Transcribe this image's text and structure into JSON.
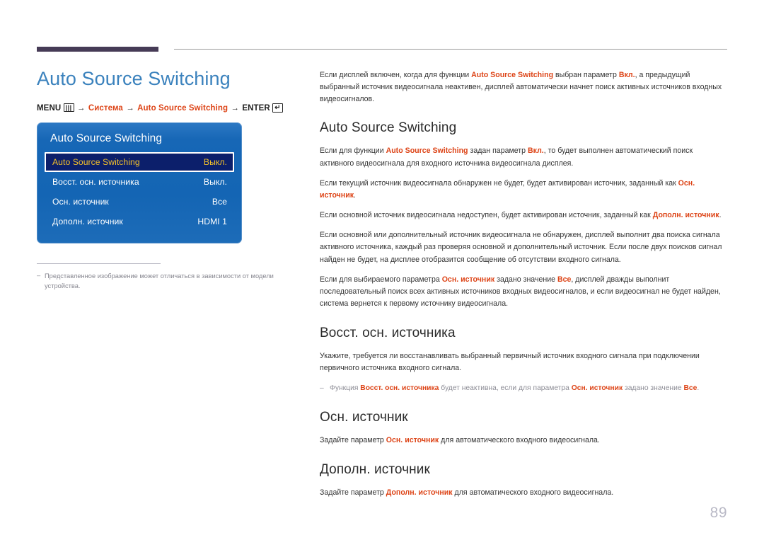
{
  "header": {
    "bar_color": "#463b56",
    "rule_color": "#9a9a9a"
  },
  "left": {
    "doc_title": "Auto Source Switching",
    "menu_path": {
      "menu_label": "MENU",
      "menu_icon": "menu-grid-icon",
      "arrow": "→",
      "step1": "Система",
      "step2": "Auto Source Switching",
      "enter_label": "ENTER",
      "enter_icon": "enter-return-icon"
    },
    "osd": {
      "title": "Auto Source Switching",
      "rows": [
        {
          "label": "Auto Source Switching",
          "value": "Выкл.",
          "selected": true
        },
        {
          "label": "Восст. осн. источника",
          "value": "Выкл.",
          "selected": false
        },
        {
          "label": "Осн. источник",
          "value": "Все",
          "selected": false
        },
        {
          "label": "Дополн. источник",
          "value": "HDMI 1",
          "selected": false
        }
      ],
      "bg_color": "#1767b6",
      "selected_bg": "#0c1f6b",
      "selected_text": "#f5c12a"
    },
    "note": {
      "dash": "‒",
      "text": "Представленное изображение может отличаться в зависимости от модели устройства."
    }
  },
  "right": {
    "intro": {
      "p1_a": "Если дисплей включен, когда для функции ",
      "p1_hl1": "Auto Source Switching",
      "p1_b": " выбран параметр ",
      "p1_hl2": "Вкл.",
      "p1_c": ", а предыдущий выбранный источник видеосигнала неактивен, дисплей автоматически начнет поиск активных источников входных видеосигналов."
    },
    "section1": {
      "heading": "Auto Source Switching",
      "p1_a": "Если для функции ",
      "p1_hl1": "Auto Source Switching",
      "p1_b": " задан параметр ",
      "p1_hl2": "Вкл.",
      "p1_c": ", то будет выполнен автоматический поиск активного видеосигнала для входного источника видеосигнала дисплея.",
      "p2_a": "Если текущий источник видеосигнала обнаружен не будет, будет активирован источник, заданный как ",
      "p2_hl": "Осн. источник",
      "p2_b": ".",
      "p3_a": "Если основной источник видеосигнала недоступен, будет активирован источник, заданный как ",
      "p3_hl": "Дополн. источник",
      "p3_b": ".",
      "p4": "Если основной или дополнительный источник видеосигнала не обнаружен, дисплей выполнит два поиска сигнала активного источника, каждый раз проверяя основной и дополнительный источник. Если после двух поисков сигнал найден не будет, на дисплее отобразится сообщение об отсутствии входного сигнала.",
      "p5_a": "Если для выбираемого параметра ",
      "p5_hl1": "Осн. источник",
      "p5_b": " задано значение ",
      "p5_hl2": "Все",
      "p5_c": ", дисплей дважды выполнит последовательный поиск всех активных источников входных видеосигналов, и если видеосигнал не будет найден, система вернется к первому источнику видеосигнала."
    },
    "section2": {
      "heading": "Восст. осн. источника",
      "p1": "Укажите, требуется ли восстанавливать выбранный первичный источник входного сигнала при подключении первичного источника входного сигнала.",
      "note_dash": "‒",
      "note_a": "Функция ",
      "note_hl1": "Восст. осн. источника",
      "note_b": " будет неактивна, если для параметра ",
      "note_hl2": "Осн. источник",
      "note_c": " задано значение ",
      "note_hl3": "Все",
      "note_d": "."
    },
    "section3": {
      "heading": "Осн. источник",
      "p1_a": "Задайте параметр ",
      "p1_hl": "Осн. источник",
      "p1_b": " для автоматического входного видеосигнала."
    },
    "section4": {
      "heading": "Дополн. источник",
      "p1_a": "Задайте параметр ",
      "p1_hl": "Дополн. источник",
      "p1_b": " для автоматического входного видеосигнала."
    }
  },
  "footer": {
    "page_number": "89"
  },
  "colors": {
    "accent_blue": "#3b82bd",
    "accent_red": "#dd4417",
    "osd_blue": "#1767b6",
    "page_number": "#b9b9c6"
  }
}
